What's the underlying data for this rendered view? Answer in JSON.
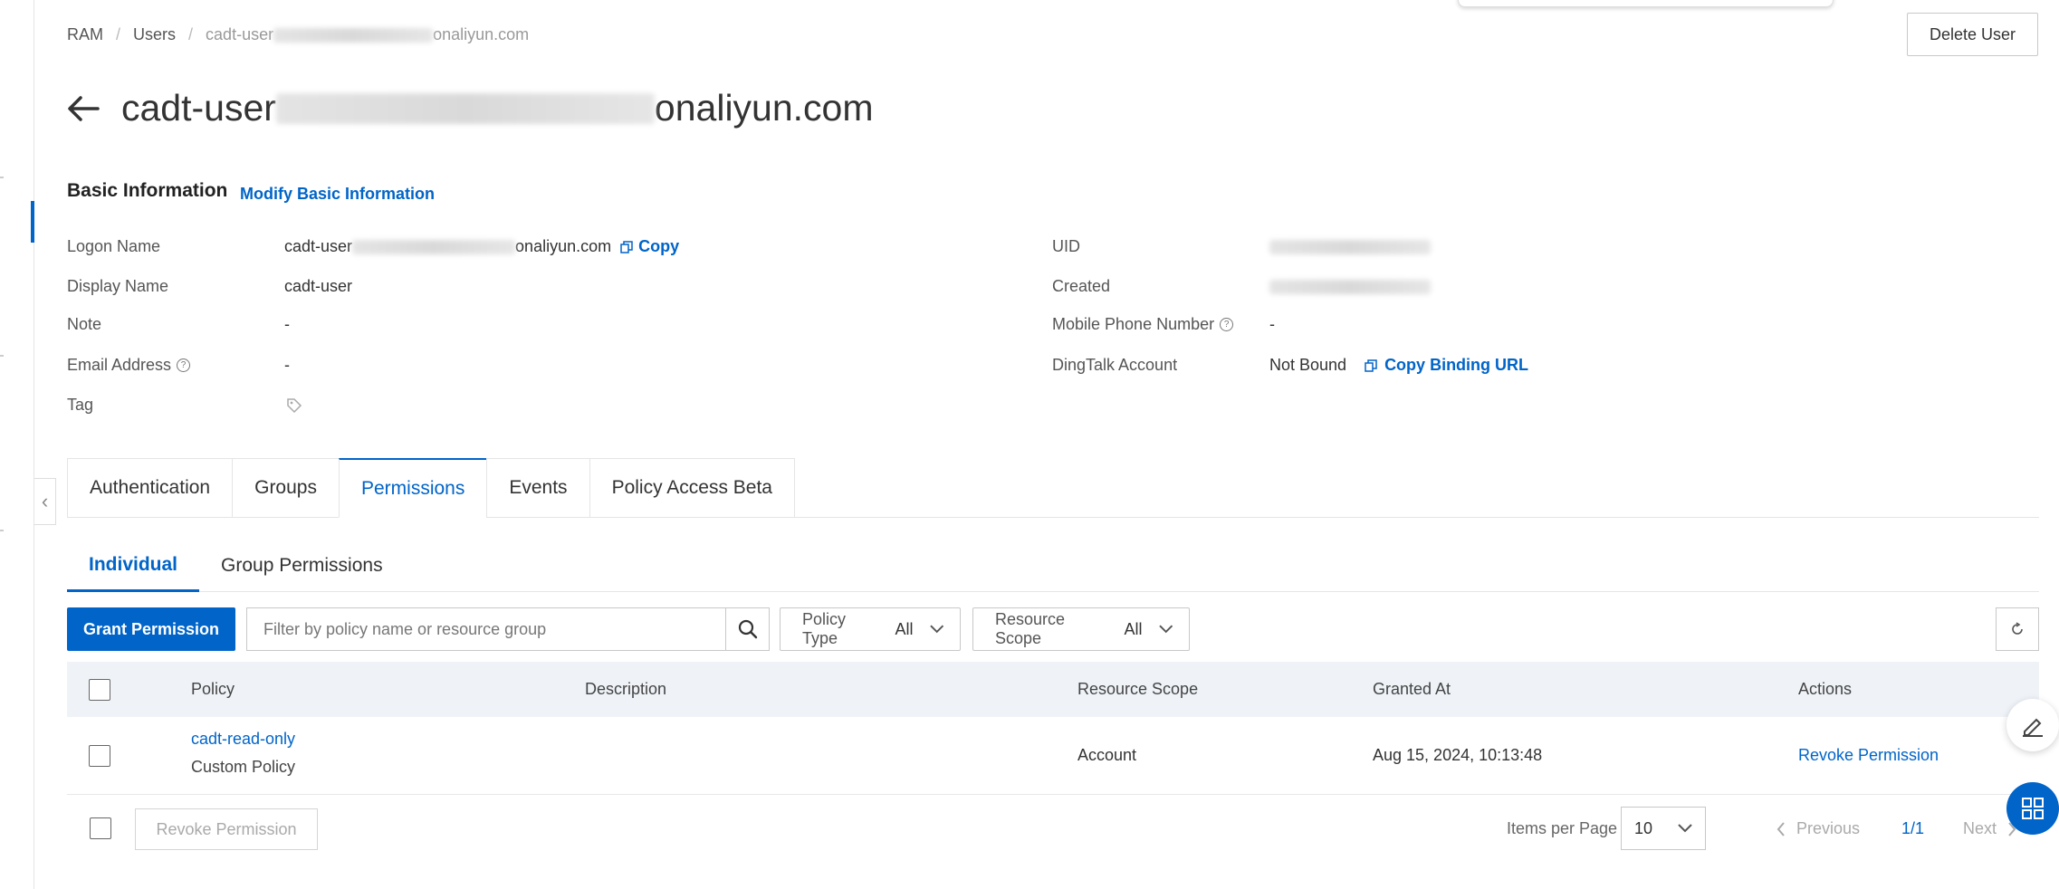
{
  "breadcrumb": {
    "root": "RAM",
    "users": "Users",
    "current_prefix": "cadt-user",
    "current_suffix": "onaliyun.com"
  },
  "header": {
    "delete_label": "Delete User",
    "title_prefix": "cadt-user",
    "title_suffix": "onaliyun.com"
  },
  "basic": {
    "section_title": "Basic Information",
    "modify_label": "Modify Basic Information",
    "logon_name_label": "Logon Name",
    "logon_name_prefix": "cadt-user",
    "logon_name_suffix": "onaliyun.com",
    "copy_label": "Copy",
    "display_name_label": "Display Name",
    "display_name_value": "cadt-user",
    "note_label": "Note",
    "note_value": "-",
    "email_label": "Email Address",
    "email_value": "-",
    "tag_label": "Tag",
    "uid_label": "UID",
    "created_label": "Created",
    "mobile_label": "Mobile Phone Number",
    "mobile_value": "-",
    "dingtalk_label": "DingTalk Account",
    "dingtalk_value": "Not Bound",
    "copy_binding_label": "Copy Binding URL"
  },
  "tabs": [
    {
      "label": "Authentication"
    },
    {
      "label": "Groups"
    },
    {
      "label": "Permissions"
    },
    {
      "label": "Events"
    },
    {
      "label": "Policy Access Beta"
    }
  ],
  "subtabs": [
    {
      "label": "Individual"
    },
    {
      "label": "Group Permissions"
    }
  ],
  "toolbar": {
    "grant_label": "Grant Permission",
    "search_placeholder": "Filter by policy name or resource group",
    "policy_type_label": "Policy Type",
    "policy_type_value": "All",
    "resource_scope_label": "Resource Scope",
    "resource_scope_value": "All"
  },
  "table": {
    "columns": [
      "Policy",
      "Description",
      "Resource Scope",
      "Granted At",
      "Actions"
    ],
    "rows": [
      {
        "policy": "cadt-read-only",
        "type": "Custom Policy",
        "description": "",
        "scope": "Account",
        "granted_at": "Aug 15, 2024, 10:13:48",
        "action": "Revoke Permission"
      }
    ]
  },
  "footer": {
    "revoke_label": "Revoke Permission",
    "items_per_page_label": "Items per Page",
    "items_per_page_value": "10",
    "previous_label": "Previous",
    "page_info": "1/1",
    "next_label": "Next"
  },
  "colors": {
    "accent": "#0064c8",
    "header_bg": "#eff3f8"
  }
}
